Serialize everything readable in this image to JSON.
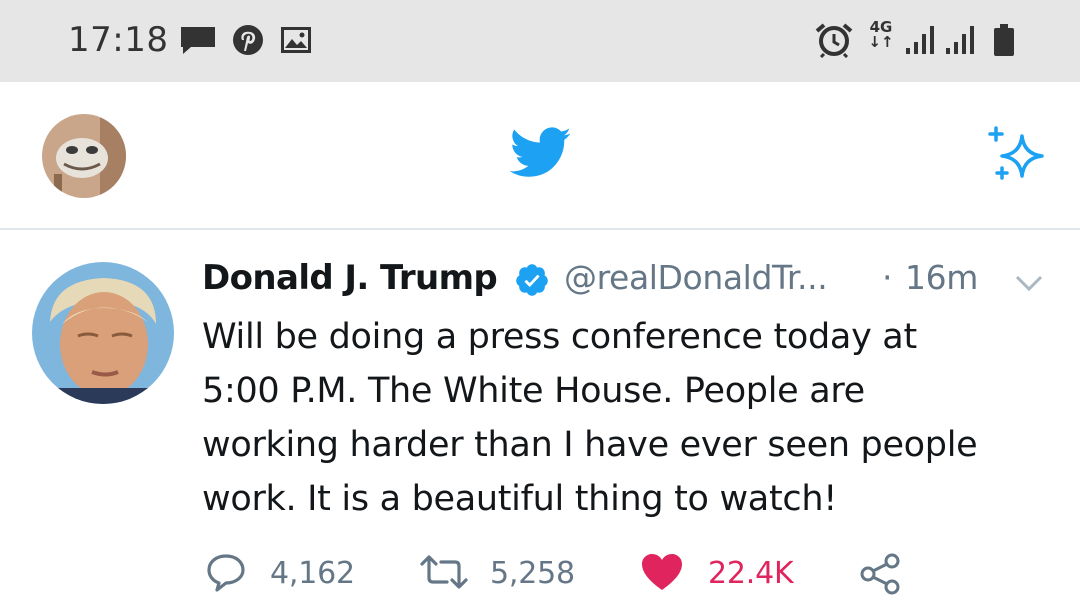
{
  "status_bar": {
    "time": "17:18",
    "network_label": "4G",
    "icons": [
      "message-icon",
      "pinterest-icon",
      "image-icon",
      "alarm-icon",
      "network-4g-icon",
      "signal-icon",
      "signal-icon",
      "battery-icon"
    ]
  },
  "top_bar": {
    "icons": [
      "profile-avatar",
      "twitter-bird-icon",
      "sparkle-icon"
    ],
    "accent_color": "#1da1f2"
  },
  "tweet": {
    "author_name": "Donald J. Trump",
    "verified": true,
    "handle": "@realDonaldTr...",
    "separator": "·",
    "time_ago": "16m",
    "text_lines": [
      "Will be doing a press conference today at",
      "5:00 P.M. The White House. People are",
      "working harder than I have ever seen people",
      "work. It is a beautiful thing to watch!"
    ],
    "actions": {
      "replies": "4,162",
      "retweets": "5,258",
      "likes": "22.4K",
      "liked": true,
      "like_color": "#e0245e"
    }
  }
}
